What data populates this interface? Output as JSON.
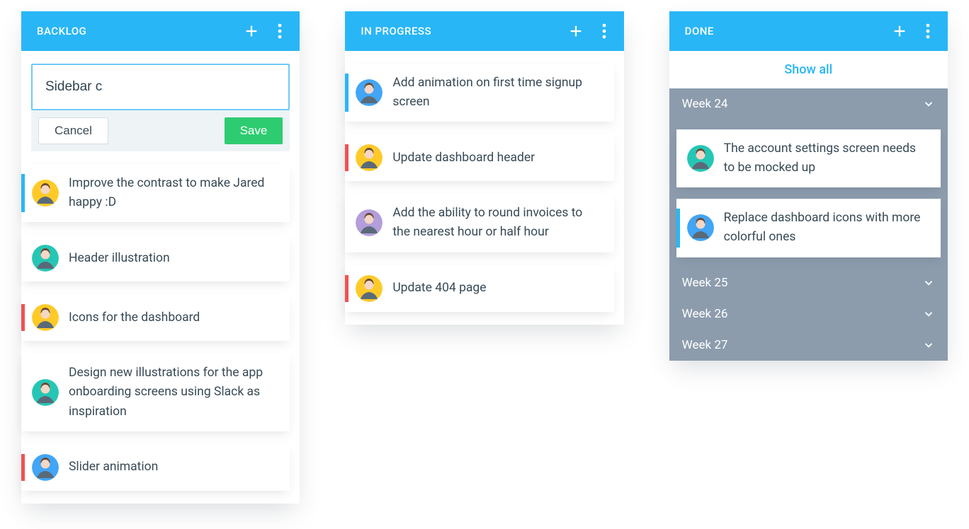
{
  "columns": {
    "backlog": {
      "title": "BACKLOG",
      "composer": {
        "value": "Sidebar c",
        "cancel": "Cancel",
        "save": "Save"
      },
      "cards": [
        {
          "text": "Improve the contrast to make Jared happy :D",
          "stripe": "blue",
          "avatar": "yellow"
        },
        {
          "text": "Header illustration",
          "stripe": "none",
          "avatar": "teal"
        },
        {
          "text": "Icons for the dashboard",
          "stripe": "red",
          "avatar": "yellow"
        },
        {
          "text": "Design new illustrations for the app onboarding screens using Slack as inspiration",
          "stripe": "none",
          "avatar": "teal"
        },
        {
          "text": "Slider animation",
          "stripe": "red",
          "avatar": "blue"
        }
      ]
    },
    "in_progress": {
      "title": "IN PROGRESS",
      "cards": [
        {
          "text": "Add animation on first time signup screen",
          "stripe": "blue",
          "avatar": "blue"
        },
        {
          "text": "Update dashboard header",
          "stripe": "red",
          "avatar": "yellow"
        },
        {
          "text": "Add the ability to round invoices to the nearest hour or half hour",
          "stripe": "none",
          "avatar": "purple"
        },
        {
          "text": "Update 404 page",
          "stripe": "red",
          "avatar": "yellow"
        }
      ]
    },
    "done": {
      "title": "DONE",
      "show_all": "Show all",
      "weeks": [
        {
          "label": "Week 24",
          "expanded": true,
          "cards": [
            {
              "text": "The account settings screen needs to be mocked up",
              "stripe": "none",
              "avatar": "teal"
            },
            {
              "text": "Replace dashboard icons with more colorful ones",
              "stripe": "blue",
              "avatar": "blue"
            }
          ]
        },
        {
          "label": "Week 25",
          "expanded": false,
          "cards": []
        },
        {
          "label": "Week 26",
          "expanded": false,
          "cards": []
        },
        {
          "label": "Week 27",
          "expanded": false,
          "cards": []
        }
      ]
    }
  },
  "avatar_colors": {
    "yellow": "#ffca28",
    "teal": "#26c6b4",
    "blue": "#42a5f5",
    "purple": "#b39ddb"
  }
}
